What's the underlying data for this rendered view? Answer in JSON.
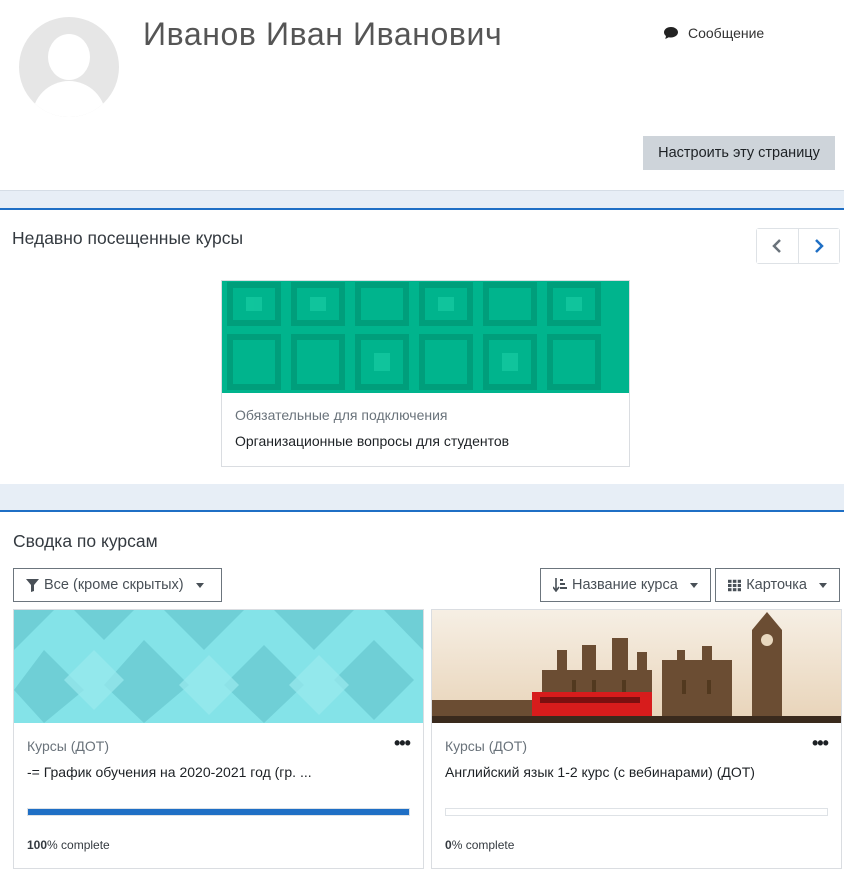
{
  "profile": {
    "name": "Иванов Иван Иванович",
    "message_label": "Сообщение",
    "customize_label": "Настроить эту страницу"
  },
  "recent": {
    "title": "Недавно посещенные курсы",
    "prev_icon": "chevron-left-icon",
    "next_icon": "chevron-right-icon",
    "course": {
      "category": "Обязательные для подключения",
      "name": "Организационные вопросы для студентов",
      "color": "#00b48d"
    }
  },
  "summary": {
    "title": "Сводка по курсам",
    "filter_label": "Все (кроме скрытых)",
    "sort_label": "Название курса",
    "view_label": "Карточка",
    "courses": [
      {
        "category": "Курсы (ДОТ)",
        "name": "-= График обучения на 2020-2021 год (гр. ...",
        "progress": 100,
        "progress_value": "100",
        "progress_suffix": "% complete",
        "color": "#7fdfe5"
      },
      {
        "category": "Курсы (ДОТ)",
        "name": "Английский язык 1-2 курс (с вебинарами) (ДОТ)",
        "progress": 0,
        "progress_value": "0",
        "progress_suffix": "% complete",
        "image": "london-parliament-photo"
      }
    ]
  },
  "colors": {
    "accent": "#1f6fc5",
    "page_bg": "#e7eef6",
    "button_gray": "#ced4da"
  }
}
